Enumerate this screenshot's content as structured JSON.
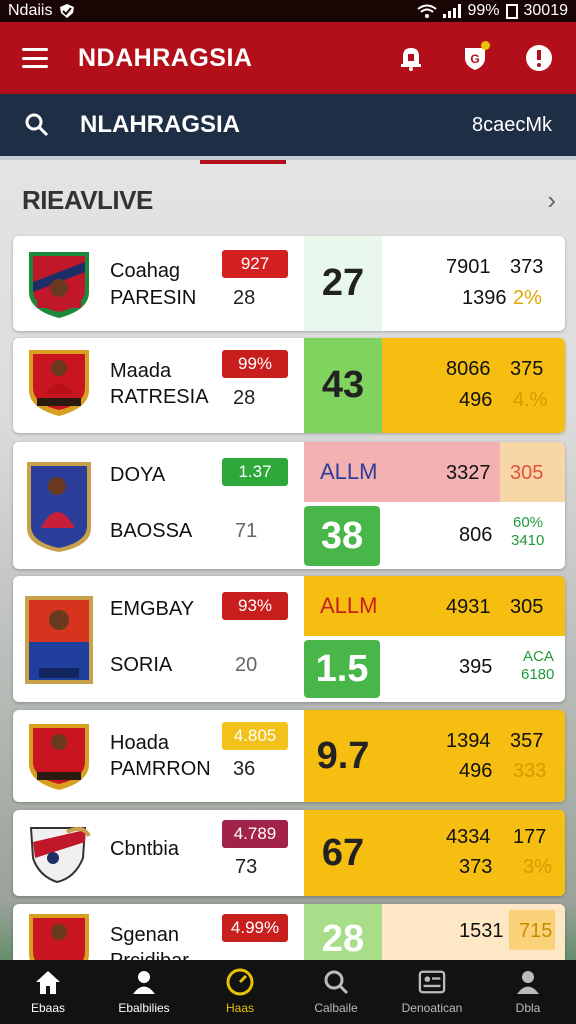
{
  "status": {
    "left_label": "Ndaiis",
    "battery": "99%",
    "time": "30019"
  },
  "app_bar": {
    "title": "NDAHRAGSIA"
  },
  "search_bar": {
    "title": "NLAHRAGSIA",
    "right_label": "8caecMk"
  },
  "section": {
    "title": "RIEAVLIVE"
  },
  "colors": {
    "brand_red": "#b30f1a",
    "navy": "#1e2f45",
    "yellow": "#f5be10",
    "green": "#49b64a",
    "pink": "#f4b1b1"
  },
  "rows": [
    {
      "name1": "Coahag",
      "name2": "PARESIN",
      "badge": "927",
      "badge_color": "#d42020",
      "sub": "28",
      "score": "27",
      "num1": "7901",
      "num2": "1396",
      "val1": "373",
      "val2": "2%"
    },
    {
      "name1": "Maada",
      "name2": "RATRESIA",
      "badge": "99%",
      "badge_color": "#c81e1e",
      "sub": "28",
      "score": "43",
      "num1": "8066",
      "num2": "496",
      "val1": "375",
      "val2": "4.%"
    },
    {
      "name1": "DOYA",
      "name2": "BAOSSA",
      "badge": "1.37",
      "badge_color": "#2fa83a",
      "sub": "71",
      "alert": "ALLM",
      "score": "38",
      "num1": "3327",
      "num2": "806",
      "val1": "305",
      "val2a": "60%",
      "val2b": "3410"
    },
    {
      "name1": "EMGBAY",
      "name2": "SORIA",
      "badge": "93%",
      "badge_color": "#c81e1e",
      "sub": "20",
      "alert": "ALLM",
      "score": "1.5",
      "num1": "4931",
      "num2": "395",
      "val1": "305",
      "val2a": "ACA",
      "val2b": "6180"
    },
    {
      "name1": "Hoada",
      "name2": "PAMRRON",
      "badge": "4.805",
      "badge_color": "#f2c21b",
      "sub": "36",
      "score": "9.7",
      "num1": "1394",
      "num2": "496",
      "val1": "357",
      "val2": "333"
    },
    {
      "name1": "Cbntbia",
      "name2": "",
      "badge": "4.789",
      "badge_color": "#a1234a",
      "sub": "73",
      "score": "67",
      "num1": "4334",
      "num2": "373",
      "val1": "177",
      "val2": "3%"
    },
    {
      "name1": "Sgenan",
      "name2": "Prcidibar",
      "badge": "4.99%",
      "badge_color": "#c81e1e",
      "sub": "",
      "score": "28",
      "num1": "1531",
      "num2": "",
      "val1": "715",
      "val2": ""
    }
  ],
  "nav": [
    {
      "label": "Ebaas",
      "icon": "home-icon"
    },
    {
      "label": "Ebalbilies",
      "icon": "person-icon"
    },
    {
      "label": "Haas",
      "icon": "gauge-icon"
    },
    {
      "label": "Calbaile",
      "icon": "search-icon"
    },
    {
      "label": "Denoatican",
      "icon": "card-icon"
    },
    {
      "label": "Dbla",
      "icon": "profile-icon"
    }
  ]
}
